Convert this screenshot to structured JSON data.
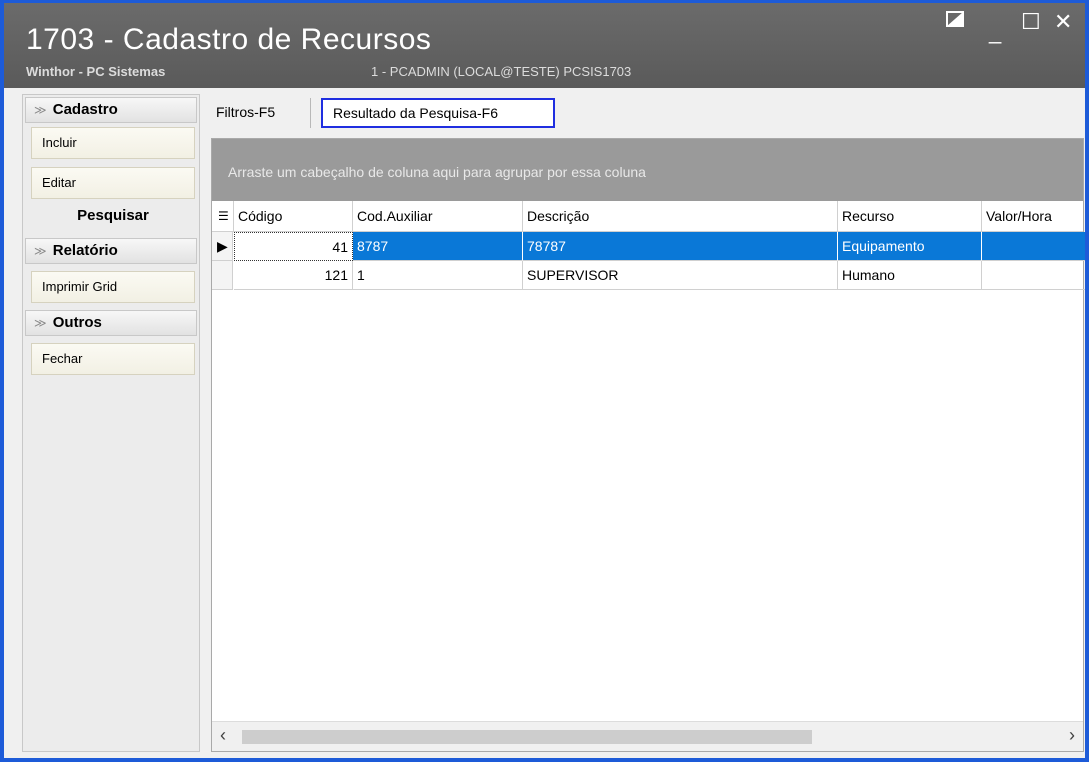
{
  "window": {
    "title": "1703 - Cadastro de Recursos",
    "subtitle": "Winthor - PC Sistemas",
    "user_info": "1 - PCADMIN (LOCAL@TESTE)   PCSIS1703",
    "controls": {
      "restore_icon": "restore-icon",
      "minimize": "_",
      "maximize": "☐",
      "close": "✕"
    }
  },
  "sidebar": {
    "cadastro": {
      "header": "Cadastro",
      "items": [
        "Incluir",
        "Editar"
      ]
    },
    "pesquisar": "Pesquisar",
    "relatorio": {
      "header": "Relatório",
      "items": [
        "Imprimir Grid"
      ]
    },
    "outros": {
      "header": "Outros",
      "items": [
        "Fechar"
      ]
    }
  },
  "tabs": {
    "filtros": "Filtros-F5",
    "resultado": "Resultado da Pesquisa-F6"
  },
  "grid": {
    "group_hint": "Arraste um cabeçalho de coluna aqui para agrupar por essa coluna",
    "columns": [
      "Código",
      "Cod.Auxiliar",
      "Descrição",
      "Recurso",
      "Valor/Hora"
    ],
    "rows": [
      {
        "codigo": "41",
        "cod_auxiliar": "8787",
        "descricao": "78787",
        "recurso": "Equipamento",
        "valor_hora": ""
      },
      {
        "codigo": "121",
        "cod_auxiliar": "1",
        "descricao": "SUPERVISOR",
        "recurso": "Humano",
        "valor_hora": ""
      }
    ],
    "selected_row": 0
  },
  "colors": {
    "accent": "#1d5bd8",
    "selection": "#0a78d7",
    "titlebar": "#636363"
  }
}
